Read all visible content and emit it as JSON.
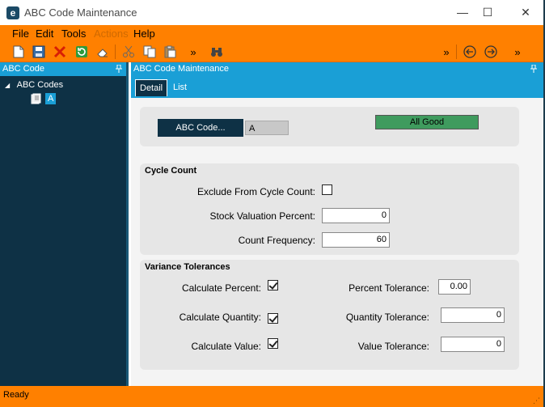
{
  "window": {
    "title": "ABC Code Maintenance",
    "logo": "e",
    "controls": {
      "minimize": "—",
      "maximize": "☐",
      "close": "✕"
    }
  },
  "menu": [
    "File",
    "Edit",
    "Tools",
    "Actions",
    "Help"
  ],
  "menu_disabled": [
    "Actions"
  ],
  "toolbar": {
    "icons": [
      "new-icon",
      "save-icon",
      "delete-icon",
      "refresh-icon",
      "eraser-icon",
      "cut-icon",
      "copy-icon",
      "paste-icon",
      "overflow-icon",
      "binoculars-icon",
      "back-icon",
      "forward-icon"
    ],
    "overflow_glyph": "»"
  },
  "left_pane": {
    "header": "ABC Code",
    "pin": "📌",
    "tree_root": "ABC Codes",
    "tree_expander": "◢",
    "tree_node": "A"
  },
  "main_pane": {
    "header": "ABC Code Maintenance",
    "pin": "📌",
    "tabs": [
      "Detail",
      "List"
    ],
    "active_tab": "Detail"
  },
  "detail": {
    "abc_code_button": "ABC Code...",
    "abc_code_value": "A",
    "status": "All Good",
    "cycle_count": {
      "title": "Cycle Count",
      "exclude_label": "Exclude From Cycle Count:",
      "exclude_checked": false,
      "stock_valuation_label": "Stock Valuation Percent:",
      "stock_valuation_value": "0",
      "count_frequency_label": "Count Frequency:",
      "count_frequency_value": "60"
    },
    "variance": {
      "title": "Variance Tolerances",
      "calc_percent_label": "Calculate Percent:",
      "calc_percent_checked": true,
      "calc_quantity_label": "Calculate Quantity:",
      "calc_quantity_checked": true,
      "calc_value_label": "Calculate Value:",
      "calc_value_checked": true,
      "percent_tolerance_label": "Percent Tolerance:",
      "percent_tolerance_value": "0.00",
      "quantity_tolerance_label": "Quantity Tolerance:",
      "quantity_tolerance_value": "0",
      "value_tolerance_label": "Value Tolerance:",
      "value_tolerance_value": "0"
    }
  },
  "statusbar": {
    "text": "Ready",
    "grip": "⋰"
  },
  "colors": {
    "accent": "#ff8000",
    "blue": "#1a9fd6",
    "navy": "#0e3145",
    "good": "#3f9b5e"
  }
}
